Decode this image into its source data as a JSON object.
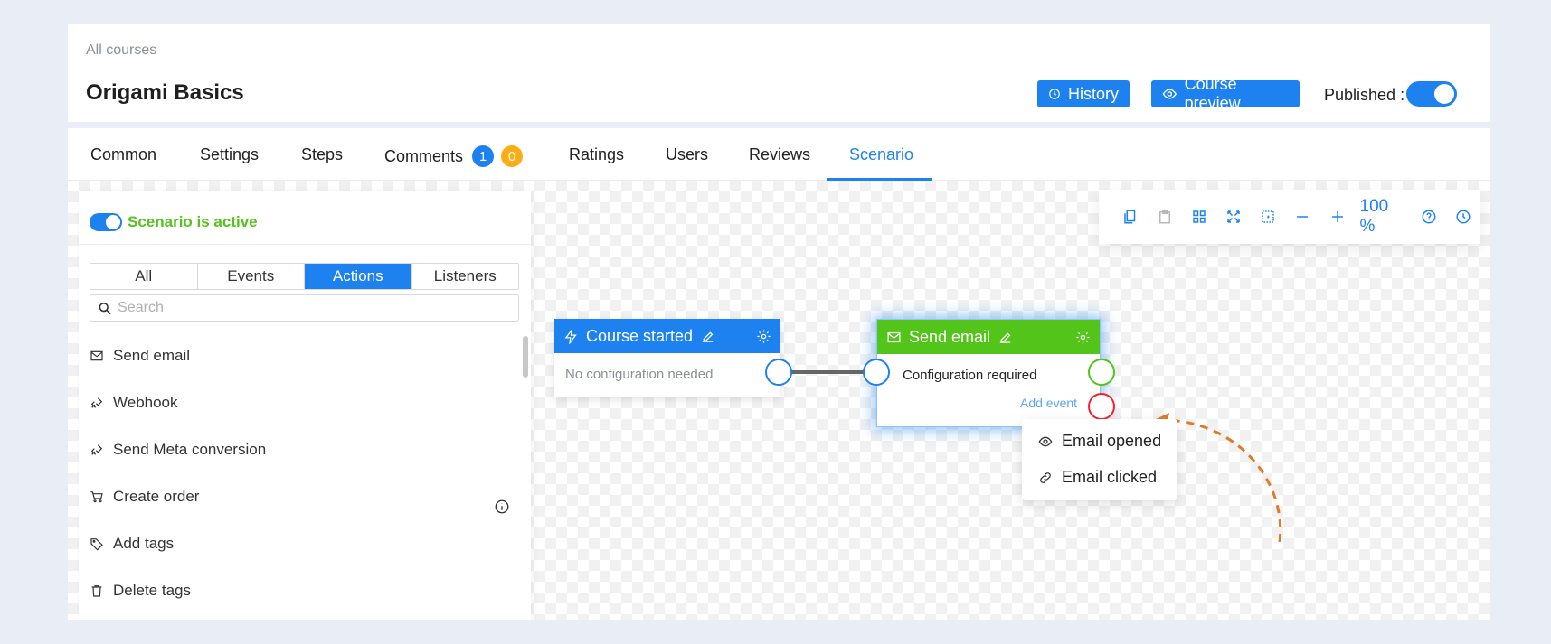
{
  "header": {
    "breadcrumb": "All courses",
    "title": "Origami Basics",
    "history_label": "History",
    "preview_label": "Course preview",
    "published_label": "Published",
    "published_on": true
  },
  "tabs": [
    {
      "label": "Common"
    },
    {
      "label": "Settings"
    },
    {
      "label": "Steps"
    },
    {
      "label": "Comments",
      "badges": [
        "1",
        "0"
      ]
    },
    {
      "label": "Ratings"
    },
    {
      "label": "Users"
    },
    {
      "label": "Reviews"
    },
    {
      "label": "Scenario",
      "active": true
    }
  ],
  "panel": {
    "active_label": "Scenario is active",
    "filters": [
      "All",
      "Events",
      "Actions",
      "Listeners"
    ],
    "selected_filter": "Actions",
    "search_placeholder": "Search",
    "items": [
      {
        "label": "Send email",
        "icon": "mail-icon"
      },
      {
        "label": "Webhook",
        "icon": "webhook-icon"
      },
      {
        "label": "Send Meta conversion",
        "icon": "webhook-icon"
      },
      {
        "label": "Create order",
        "icon": "cart-icon"
      },
      {
        "label": "Add tags",
        "icon": "tag-icon"
      },
      {
        "label": "Delete tags",
        "icon": "trash-icon"
      }
    ]
  },
  "toolbar": {
    "zoom": "100 %",
    "icons": [
      "copy-icon",
      "paste-icon",
      "grid-icon",
      "fit-icon",
      "select-area-icon",
      "zoom-out-icon",
      "zoom-in-icon",
      "help-icon",
      "history-icon"
    ]
  },
  "nodes": {
    "course_started": {
      "title": "Course started",
      "body": "No configuration needed",
      "color": "#1d82f0"
    },
    "send_email": {
      "title": "Send email",
      "body": "Configuration required",
      "add_event": "Add event",
      "color": "#52c41a"
    }
  },
  "event_menu": [
    {
      "label": "Email opened",
      "icon": "eye-icon"
    },
    {
      "label": "Email clicked",
      "icon": "link-icon"
    }
  ],
  "colors": {
    "accent": "#1d82f0",
    "success": "#52c41a",
    "warning": "#faad14",
    "danger": "#f5222d",
    "arrow": "#e07b28"
  }
}
